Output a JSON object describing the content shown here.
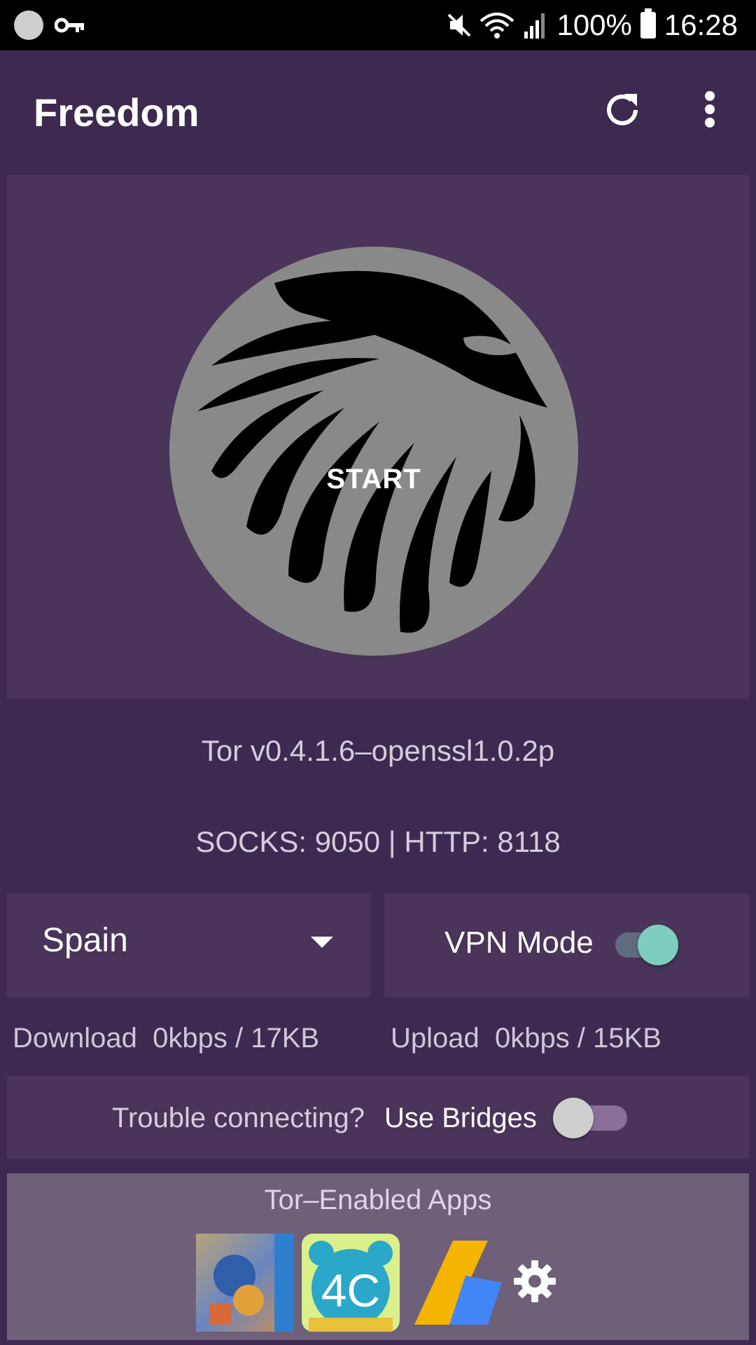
{
  "status_bar": {
    "battery": "100%",
    "time": "16:28"
  },
  "app_bar": {
    "title": "Freedom",
    "refresh_icon": "refresh-icon",
    "overflow_icon": "more-vert-icon"
  },
  "hero": {
    "start_label": "START",
    "logo": "eagle-logo"
  },
  "info": {
    "tor_version": "Tor v0.4.1.6–openssl1.0.2p",
    "ports": "SOCKS: 9050 | HTTP: 8118"
  },
  "country_select": {
    "value": "Spain"
  },
  "vpn": {
    "label": "VPN Mode",
    "enabled": true
  },
  "traffic": {
    "download": "Download  0kbps / 17KB",
    "upload": "Upload  0kbps / 15KB"
  },
  "bridges": {
    "prompt": "Trouble connecting?",
    "label": "Use Bridges",
    "enabled": false
  },
  "apps": {
    "title": "Tor–Enabled Apps",
    "app2_text": "4C",
    "settings_icon": "gear-icon"
  },
  "colors": {
    "background": "#3e2a50",
    "panel": "#4a3459",
    "accent_teal": "#7ecec0",
    "apps_panel": "#6e6078"
  }
}
